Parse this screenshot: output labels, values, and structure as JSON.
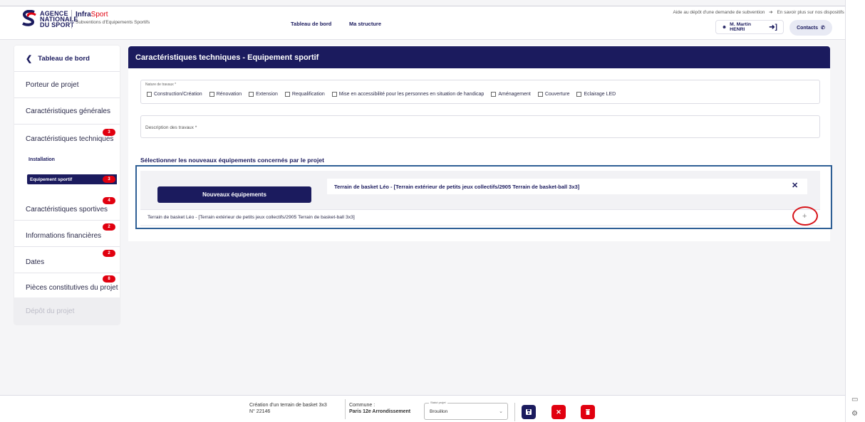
{
  "header": {
    "logo_lines": [
      "AGENCE",
      "NATIONALE",
      "DU SPORT"
    ],
    "brand_prefix": "Infra",
    "brand_suffix": "Sport",
    "brand_subtitle": "Subventions d'Equipements Sportifs",
    "nav": [
      "Tableau de bord",
      "Ma structure"
    ],
    "toplinks": [
      "Aide au dépôt d'une demande de subvention",
      "En savoir plus sur nos dispositifs"
    ],
    "user": "M. Martin HENRI",
    "contacts": "Contacts"
  },
  "sidebar": {
    "back": "Tableau de bord",
    "items": [
      {
        "label": "Porteur de projet",
        "badge": ""
      },
      {
        "label": "Caractéristiques générales",
        "badge": ""
      },
      {
        "label": "Caractéristiques techniques",
        "badge": "3"
      },
      {
        "label": "Caractéristiques sportives",
        "badge": "4"
      },
      {
        "label": "Informations financières",
        "badge": "2"
      },
      {
        "label": "Dates",
        "badge": "2"
      },
      {
        "label": "Pièces constitutives du projet",
        "badge": "8"
      }
    ],
    "sub_items": [
      {
        "label": "Installation",
        "badge": ""
      },
      {
        "label": "Equipement sportif",
        "badge": "3"
      }
    ],
    "disabled_item": "Dépôt du projet"
  },
  "main": {
    "title": "Caractéristiques techniques - Equipement sportif",
    "nature_label": "Nature de travaux *",
    "nature_options": [
      "Construction/Création",
      "Rénovation",
      "Extension",
      "Requalification",
      "Mise en accessibilité pour les personnes en situation de handicap",
      "Aménagement",
      "Couverture",
      "Eclairage LED"
    ],
    "description_label": "Description des travaux *",
    "select_title": "Sélectionner les nouveaux équipements concernés par le projet",
    "new_equipment_button": "Nouveaux équipements",
    "selected_equipment": "Terrain de basket Léo - [Terrain extérieur de petits jeux collectifs/2905 Terrain de basket-ball 3x3]",
    "equipment_row": "Terrain de basket Léo - [Terrain extérieur de petits jeux collectifs/2905 Terrain de basket-ball 3x3]"
  },
  "footer": {
    "project_name": "Création d'un terrain de basket 3x3",
    "project_number": "N° 22146",
    "commune_label": "Commune :",
    "commune_value": "Paris 12e Arrondissement",
    "status_label": "Statut projet",
    "status_value": "Brouillon"
  },
  "colors": {
    "primary": "#1b1b5e",
    "danger": "#e1000f",
    "highlight": "#2e5f95"
  }
}
